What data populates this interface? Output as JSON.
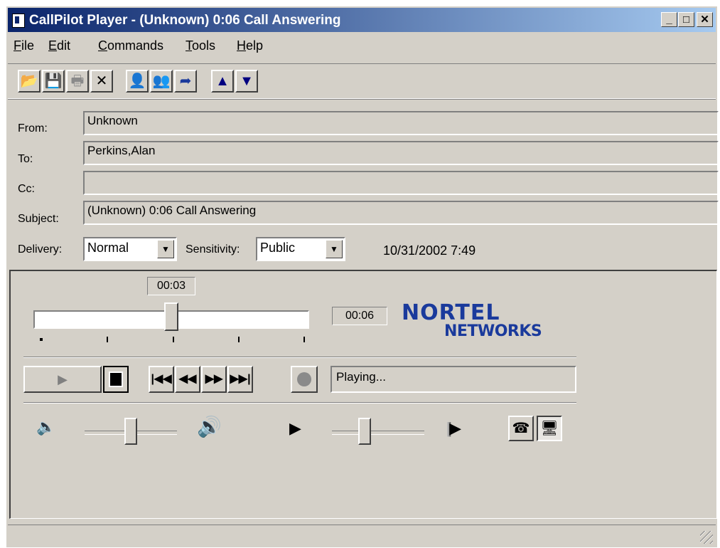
{
  "window": {
    "title": "CallPilot Player - (Unknown) 0:06 Call Answering"
  },
  "caption_buttons": {
    "minimize": "_",
    "maximize": "□",
    "close": "✕"
  },
  "menu": [
    {
      "label": "File",
      "key": "F",
      "rest": "ile"
    },
    {
      "label": "Edit",
      "key": "E",
      "rest": "dit"
    },
    {
      "label": "Commands",
      "key": "C",
      "rest": "ommands"
    },
    {
      "label": "Tools",
      "key": "T",
      "rest": "ools"
    },
    {
      "label": "Help",
      "key": "H",
      "rest": "elp"
    }
  ],
  "toolbar": [
    {
      "name": "open-icon",
      "glyph": "📂",
      "enabled": false
    },
    {
      "name": "save-icon",
      "glyph": "💾",
      "enabled": false
    },
    {
      "name": "print-icon",
      "glyph": "🖶",
      "enabled": false
    },
    {
      "name": "delete-icon",
      "glyph": "✕",
      "enabled": true
    },
    {
      "name": "reply-icon",
      "glyph": "👤",
      "enabled": true
    },
    {
      "name": "reply-all-icon",
      "glyph": "👥",
      "enabled": true
    },
    {
      "name": "forward-icon",
      "glyph": "➦",
      "enabled": true
    },
    {
      "name": "previous-message-icon",
      "glyph": "▲",
      "enabled": true
    },
    {
      "name": "next-message-icon",
      "glyph": "▼",
      "enabled": true
    }
  ],
  "header": {
    "from_label": "From:",
    "from_value": "Unknown",
    "to_label": "To:",
    "to_value": "Perkins,Alan",
    "cc_label": "Cc:",
    "cc_value": "",
    "subject_label": "Subject:",
    "subject_value": "(Unknown) 0:06 Call Answering",
    "delivery_label": "Delivery:",
    "delivery_value": "Normal",
    "sensitivity_label": "Sensitivity:",
    "sensitivity_value": "Public",
    "timestamp": "10/31/2002 7:49"
  },
  "player": {
    "current_time": "00:03",
    "total_time": "00:06",
    "progress": 0.5,
    "status": "Playing...",
    "logo_line1": "NORTEL",
    "logo_line2": "NETWORKS",
    "volume_level": 0.5,
    "speed_level": 0.35
  },
  "colors": {
    "title_start": "#0a246a",
    "title_end": "#a6caf0",
    "logo": "#1a3a9c"
  }
}
